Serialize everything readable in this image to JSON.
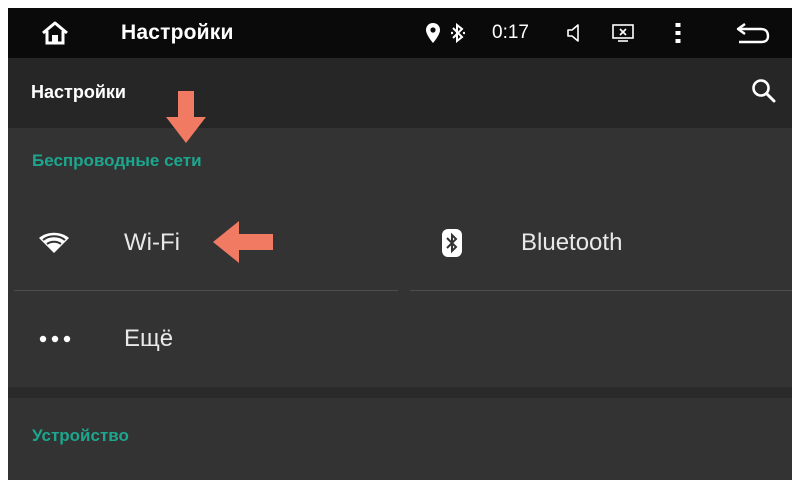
{
  "status_bar": {
    "home_icon": "home-icon",
    "title": "Настройки",
    "location_icon": "location-pin-icon",
    "bluetooth_icon": "bluetooth-icon",
    "time": "0:17",
    "volume_icon": "volume-icon",
    "screen_icon": "screen-off-icon",
    "more_icon": "more-vertical-icon",
    "back_icon": "back-icon"
  },
  "action_bar": {
    "title": "Настройки",
    "search_icon": "search-icon"
  },
  "sections": [
    {
      "header": "Беспроводные сети",
      "items": [
        {
          "label": "Wi-Fi",
          "icon": "wifi-icon"
        },
        {
          "label": "Bluetooth",
          "icon": "bluetooth-icon"
        },
        {
          "label": "Ещё",
          "icon": "more-horizontal-icon"
        }
      ]
    },
    {
      "header": "Устройство",
      "items": []
    }
  ],
  "colors": {
    "accent": "#1da68e",
    "background": "#333333",
    "status_bar": "#0a0a0a",
    "action_bar": "#262626",
    "annotation_arrow": "#f07a62"
  }
}
